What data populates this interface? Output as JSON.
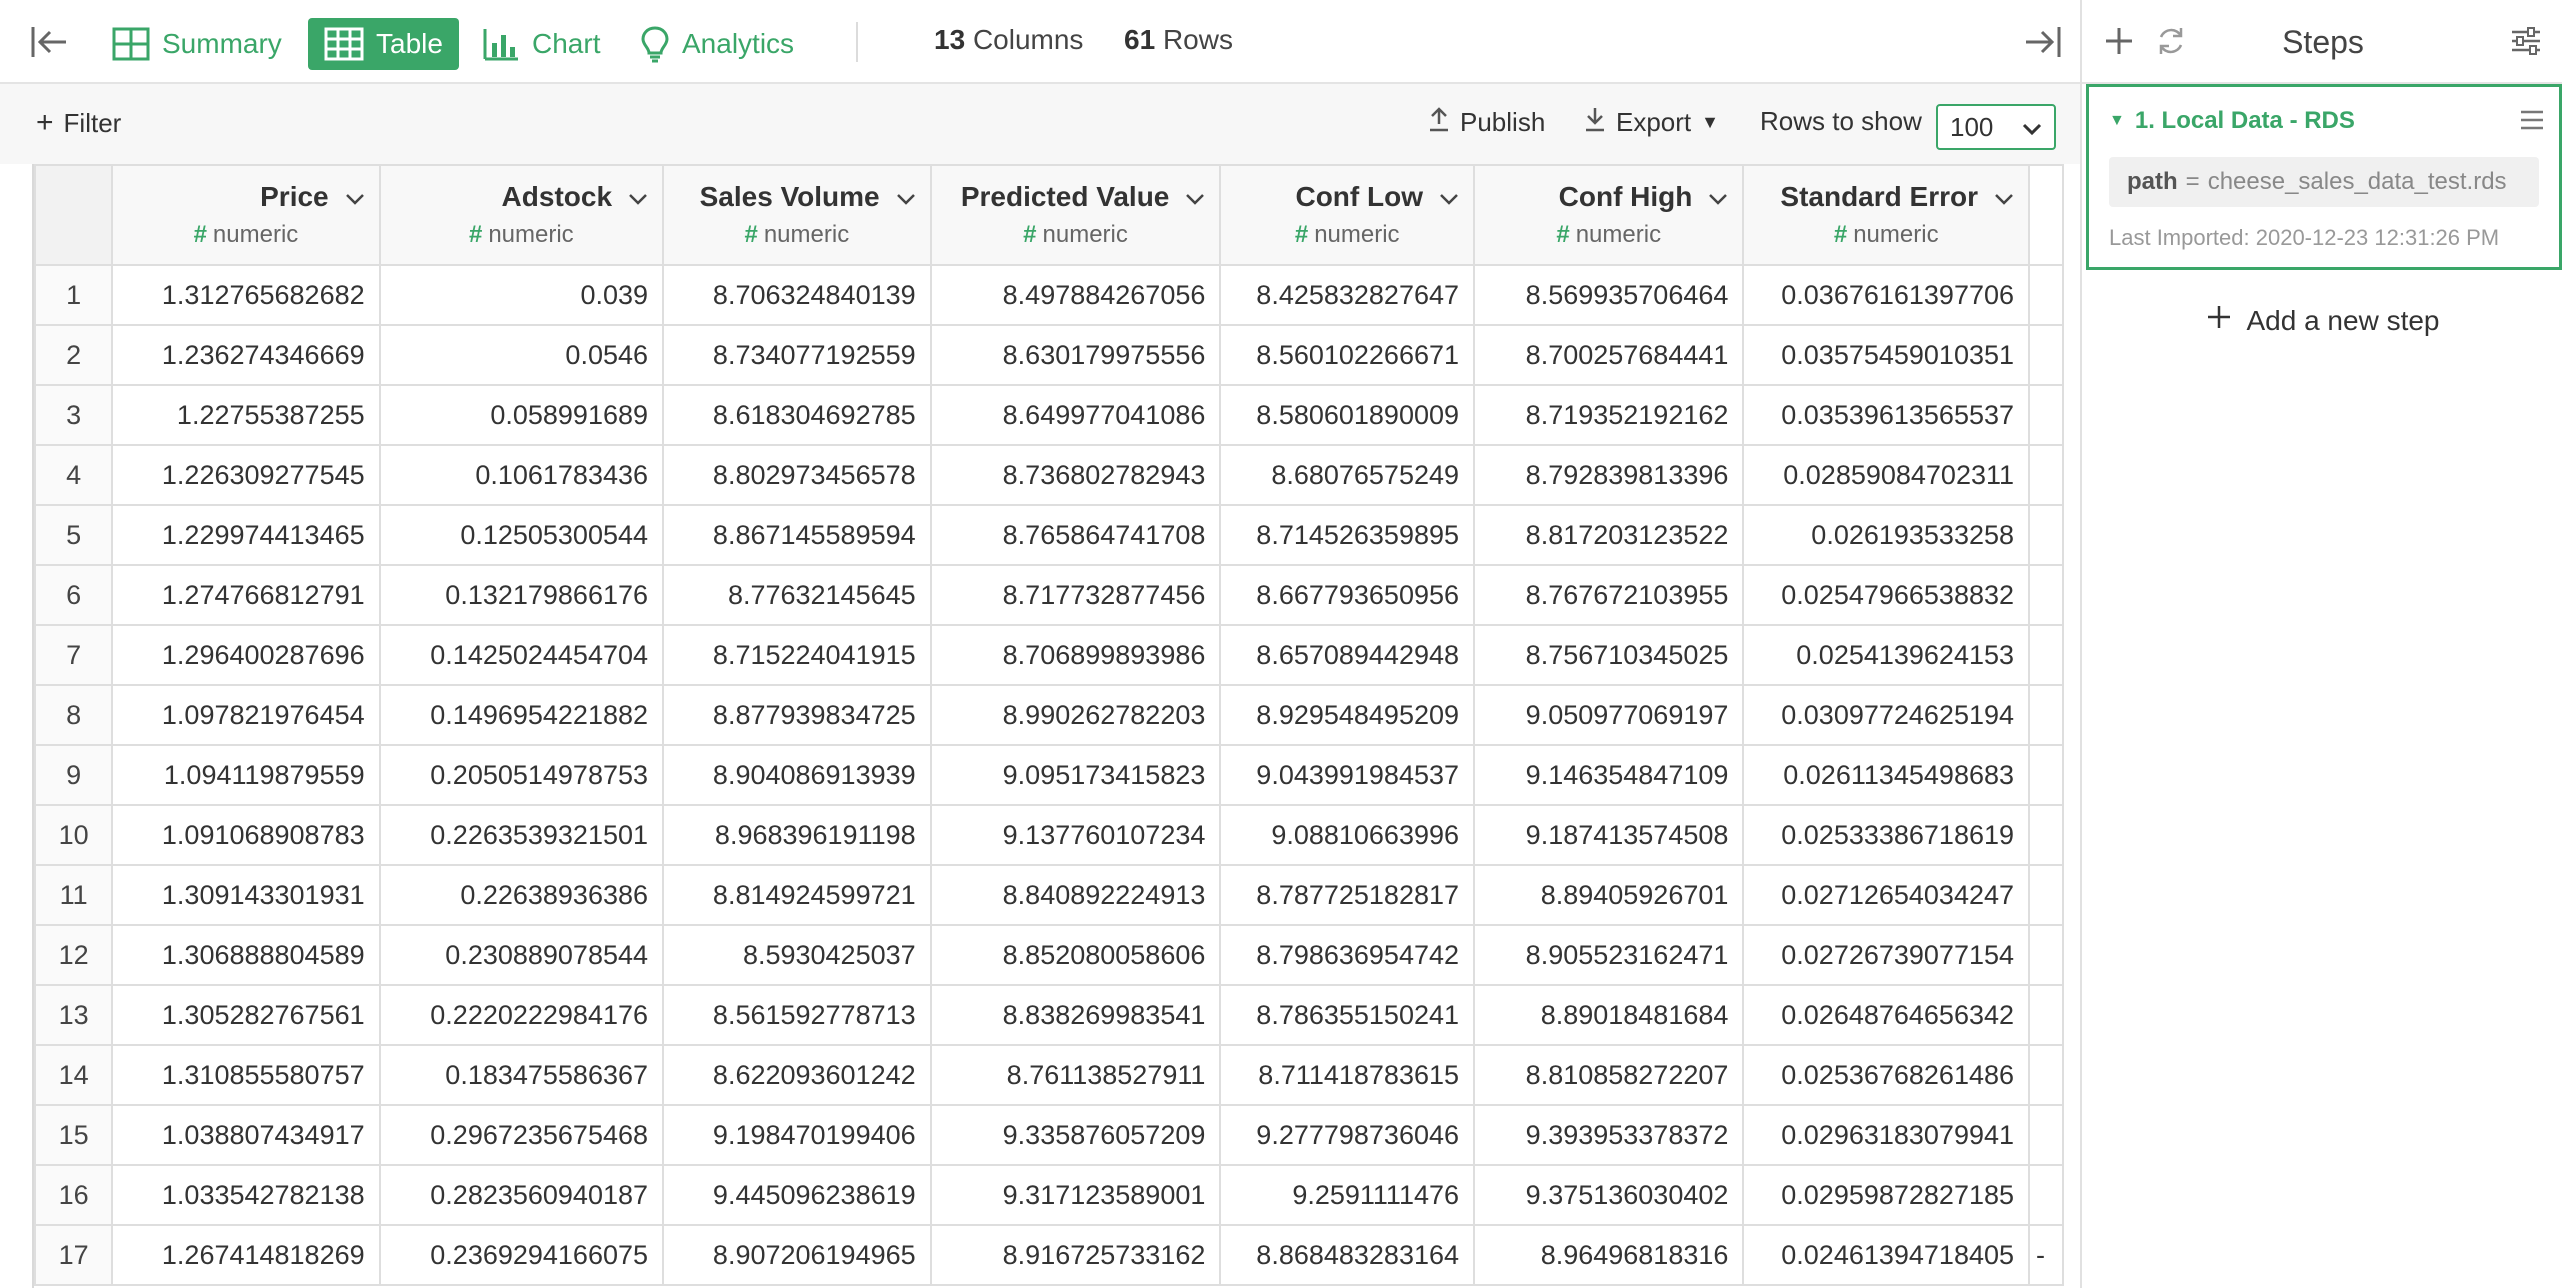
{
  "topbar": {
    "tabs": [
      {
        "label": "Summary"
      },
      {
        "label": "Table"
      },
      {
        "label": "Chart"
      },
      {
        "label": "Analytics"
      }
    ],
    "columns_count": "13",
    "columns_word": "Columns",
    "rows_count": "61",
    "rows_word": "Rows"
  },
  "toolbar": {
    "filter_label": "Filter",
    "publish_label": "Publish",
    "export_label": "Export",
    "rows_to_show_label": "Rows to show",
    "rows_to_show_value": "100"
  },
  "table": {
    "columns": [
      {
        "name": "Price",
        "type": "numeric"
      },
      {
        "name": "Adstock",
        "type": "numeric"
      },
      {
        "name": "Sales Volume",
        "type": "numeric"
      },
      {
        "name": "Predicted Value",
        "type": "numeric"
      },
      {
        "name": "Conf Low",
        "type": "numeric"
      },
      {
        "name": "Conf High",
        "type": "numeric"
      },
      {
        "name": "Standard Error",
        "type": "numeric"
      }
    ],
    "rows": [
      {
        "n": "1",
        "cells": [
          "1.312765682682",
          "0.039",
          "8.706324840139",
          "8.497884267056",
          "8.425832827647",
          "8.569935706464",
          "0.03676161397706"
        ]
      },
      {
        "n": "2",
        "cells": [
          "1.236274346669",
          "0.0546",
          "8.734077192559",
          "8.630179975556",
          "8.560102266671",
          "8.700257684441",
          "0.03575459010351"
        ]
      },
      {
        "n": "3",
        "cells": [
          "1.22755387255",
          "0.058991689",
          "8.618304692785",
          "8.649977041086",
          "8.580601890009",
          "8.719352192162",
          "0.03539613565537"
        ]
      },
      {
        "n": "4",
        "cells": [
          "1.226309277545",
          "0.1061783436",
          "8.802973456578",
          "8.736802782943",
          "8.68076575249",
          "8.792839813396",
          "0.02859084702311"
        ]
      },
      {
        "n": "5",
        "cells": [
          "1.229974413465",
          "0.12505300544",
          "8.867145589594",
          "8.765864741708",
          "8.714526359895",
          "8.817203123522",
          "0.026193533258"
        ]
      },
      {
        "n": "6",
        "cells": [
          "1.274766812791",
          "0.132179866176",
          "8.77632145645",
          "8.717732877456",
          "8.667793650956",
          "8.767672103955",
          "0.02547966538832"
        ]
      },
      {
        "n": "7",
        "cells": [
          "1.296400287696",
          "0.1425024454704",
          "8.715224041915",
          "8.706899893986",
          "8.657089442948",
          "8.756710345025",
          "0.0254139624153"
        ]
      },
      {
        "n": "8",
        "cells": [
          "1.097821976454",
          "0.1496954221882",
          "8.877939834725",
          "8.990262782203",
          "8.929548495209",
          "9.050977069197",
          "0.03097724625194"
        ]
      },
      {
        "n": "9",
        "cells": [
          "1.094119879559",
          "0.2050514978753",
          "8.904086913939",
          "9.095173415823",
          "9.043991984537",
          "9.146354847109",
          "0.02611345498683"
        ]
      },
      {
        "n": "10",
        "cells": [
          "1.091068908783",
          "0.2263539321501",
          "8.968396191198",
          "9.137760107234",
          "9.08810663996",
          "9.187413574508",
          "0.02533386718619"
        ]
      },
      {
        "n": "11",
        "cells": [
          "1.309143301931",
          "0.22638936386",
          "8.814924599721",
          "8.840892224913",
          "8.787725182817",
          "8.89405926701",
          "0.02712654034247"
        ]
      },
      {
        "n": "12",
        "cells": [
          "1.306888804589",
          "0.230889078544",
          "8.5930425037",
          "8.852080058606",
          "8.798636954742",
          "8.905523162471",
          "0.02726739077154"
        ]
      },
      {
        "n": "13",
        "cells": [
          "1.305282767561",
          "0.2220222984176",
          "8.561592778713",
          "8.838269983541",
          "8.786355150241",
          "8.89018481684",
          "0.02648764656342"
        ]
      },
      {
        "n": "14",
        "cells": [
          "1.310855580757",
          "0.183475586367",
          "8.622093601242",
          "8.761138527911",
          "8.711418783615",
          "8.810858272207",
          "0.02536768261486"
        ]
      },
      {
        "n": "15",
        "cells": [
          "1.038807434917",
          "0.2967235675468",
          "9.198470199406",
          "9.335876057209",
          "9.277798736046",
          "9.393953378372",
          "0.02963183079941"
        ]
      },
      {
        "n": "16",
        "cells": [
          "1.033542782138",
          "0.2823560940187",
          "9.445096238619",
          "9.317123589001",
          "9.2591111476",
          "9.375136030402",
          "0.02959872827185"
        ]
      },
      {
        "n": "17",
        "cells": [
          "1.267414818269",
          "0.2369294166075",
          "8.907206194965",
          "8.916725733162",
          "8.868483283164",
          "8.96496818316",
          "0.02461394718405"
        ]
      }
    ],
    "overflow_marker": "-"
  },
  "steps": {
    "title": "Steps",
    "step_title": "1. Local Data - RDS",
    "param_key": "path",
    "param_eq": "=",
    "param_value": "cheese_sales_data_test.rds",
    "meta": "Last Imported: 2020-12-23 12:31:26 PM",
    "add_label": "Add a new step"
  },
  "colors": {
    "accent": "#3aa668",
    "border": "#dedede",
    "header_bg": "#f8f8f8"
  }
}
